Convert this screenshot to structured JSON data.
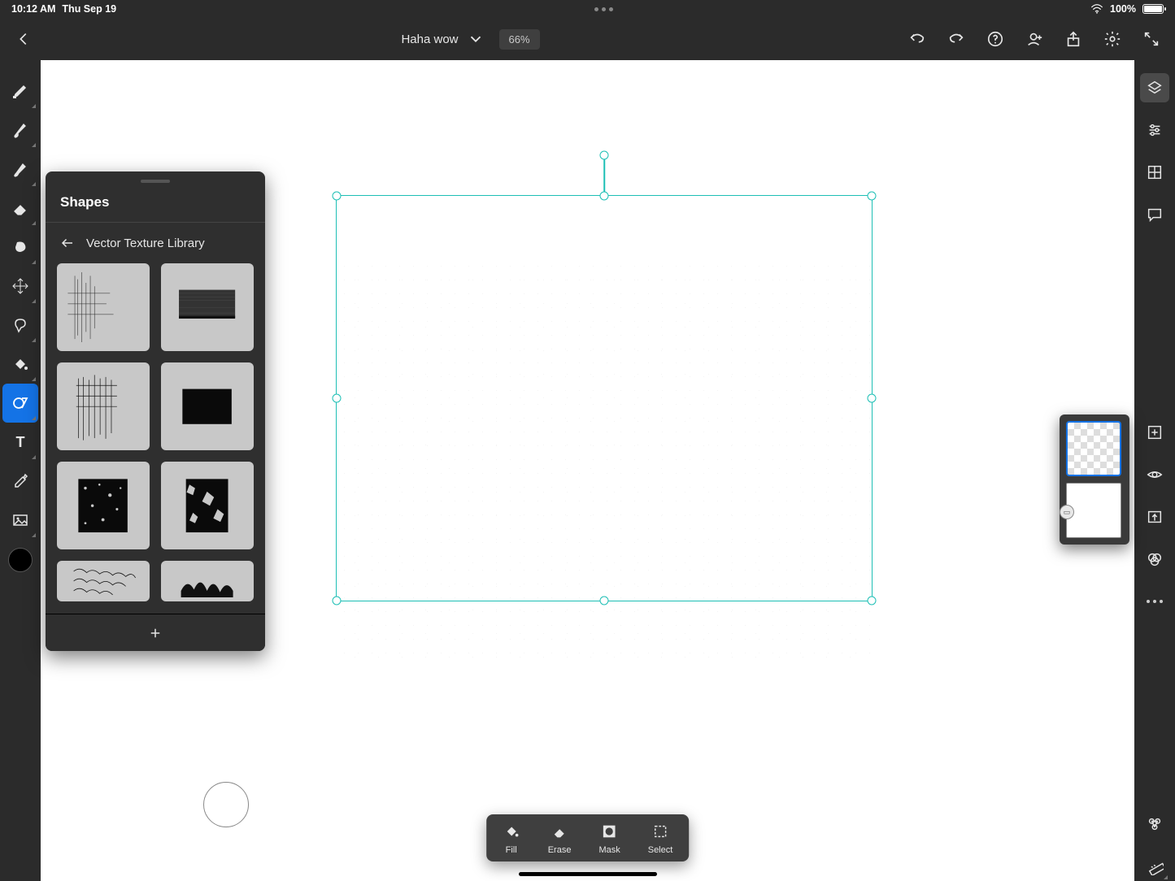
{
  "status": {
    "time": "10:12 AM",
    "date": "Thu Sep 19",
    "battery": "100%"
  },
  "header": {
    "doc_title": "Haha wow",
    "zoom": "66%"
  },
  "left_tools": [
    "pixel-brush",
    "smudge",
    "paint-brush",
    "eraser",
    "blob",
    "transform",
    "lasso",
    "fill",
    "shapes",
    "text",
    "eyedropper",
    "image"
  ],
  "right_tools": [
    "layers",
    "properties",
    "grid",
    "comments",
    "add-layer",
    "visibility",
    "quick-export",
    "appearance",
    "more"
  ],
  "shapes_panel": {
    "title": "Shapes",
    "library": "Vector Texture Library",
    "items": [
      "tex-1",
      "tex-2",
      "tex-3",
      "tex-4",
      "tex-5",
      "tex-6",
      "tex-7",
      "tex-8"
    ]
  },
  "bottom_bar": {
    "fill": "Fill",
    "erase": "Erase",
    "mask": "Mask",
    "select": "Select"
  },
  "layers": [
    {
      "id": "layer-1",
      "type": "transparent",
      "selected": true
    },
    {
      "id": "layer-2",
      "type": "image",
      "selected": false
    }
  ]
}
